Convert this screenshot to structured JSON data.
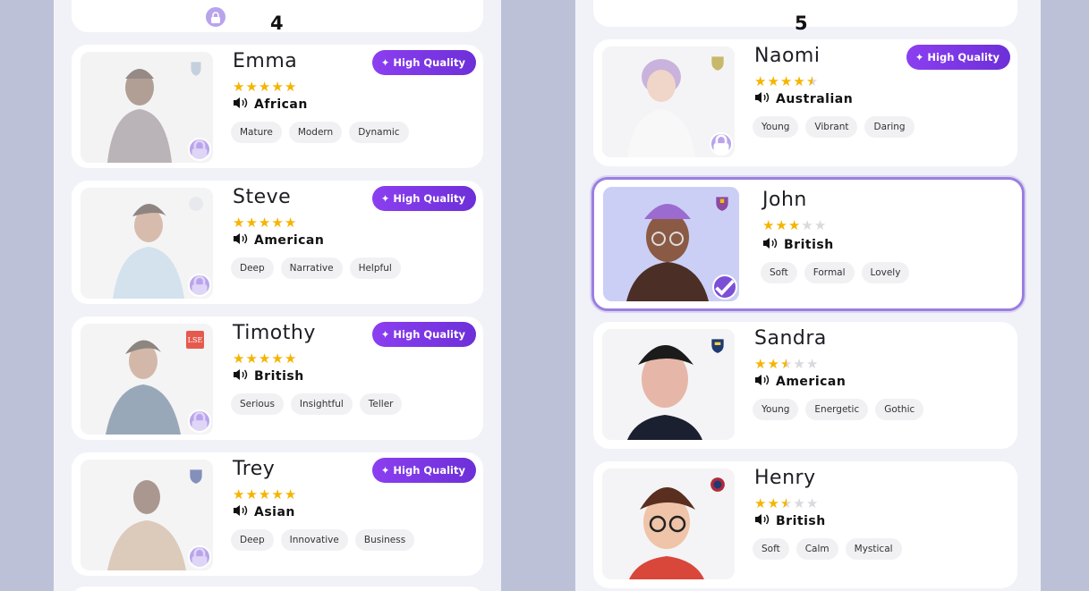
{
  "steps": {
    "left": "4",
    "right": "5"
  },
  "hq_label": "High Quality",
  "left_cards": [
    {
      "name": "Emma",
      "stars": [
        1,
        1,
        1,
        1,
        1
      ],
      "accent": "African",
      "tags": [
        "Mature",
        "Modern",
        "Dynamic"
      ]
    },
    {
      "name": "Steve",
      "stars": [
        1,
        1,
        1,
        1,
        1
      ],
      "accent": "American",
      "tags": [
        "Deep",
        "Narrative",
        "Helpful"
      ]
    },
    {
      "name": "Timothy",
      "stars": [
        1,
        1,
        1,
        1,
        1
      ],
      "accent": "British",
      "tags": [
        "Serious",
        "Insightful",
        "Teller"
      ]
    },
    {
      "name": "Trey",
      "stars": [
        1,
        1,
        1,
        1,
        1
      ],
      "accent": "Asian",
      "tags": [
        "Deep",
        "Innovative",
        "Business"
      ]
    }
  ],
  "right_cards": [
    {
      "name": "Naomi",
      "stars": [
        1,
        1,
        1,
        1,
        0.5
      ],
      "accent": "Australian",
      "tags": [
        "Young",
        "Vibrant",
        "Daring"
      ]
    },
    {
      "name": "John",
      "stars": [
        1,
        1,
        1,
        0,
        0
      ],
      "accent": "British",
      "tags": [
        "Soft",
        "Formal",
        "Lovely"
      ]
    },
    {
      "name": "Sandra",
      "stars": [
        1,
        1,
        0.5,
        0,
        0
      ],
      "accent": "American",
      "tags": [
        "Young",
        "Energetic",
        "Gothic"
      ]
    },
    {
      "name": "Henry",
      "stars": [
        1,
        1,
        0.5,
        0,
        0
      ],
      "accent": "British",
      "tags": [
        "Soft",
        "Calm",
        "Mystical"
      ]
    }
  ],
  "badges": {
    "timothy_school": "LSE"
  },
  "colors": {
    "accent_purple": "#7b4fd6",
    "star": "#f5b400",
    "selected_border": "#9b7fe0",
    "background": "#bdc1d8"
  }
}
